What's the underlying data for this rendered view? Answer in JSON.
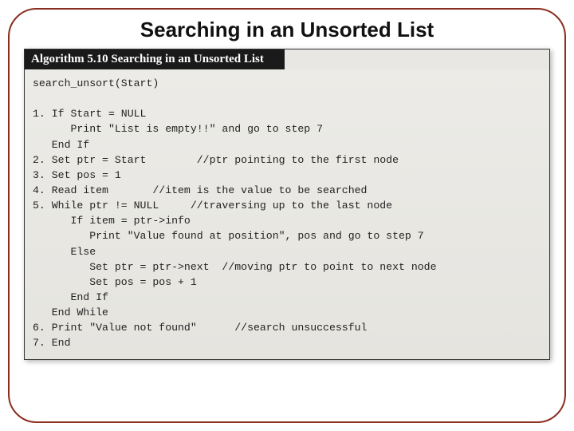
{
  "title": "Searching in an Unsorted List",
  "algorithm": {
    "header": "Algorithm 5.10 Searching in an Unsorted List",
    "signature": "search_unsort(Start)",
    "lines": [
      "1. If Start = NULL",
      "      Print \"List is empty!!\" and go to step 7",
      "   End If",
      "2. Set ptr = Start        //ptr pointing to the first node",
      "3. Set pos = 1",
      "4. Read item       //item is the value to be searched",
      "5. While ptr != NULL     //traversing up to the last node",
      "      If item = ptr->info",
      "         Print \"Value found at position\", pos and go to step 7",
      "      Else",
      "         Set ptr = ptr->next  //moving ptr to point to next node",
      "         Set pos = pos + 1",
      "      End If",
      "   End While",
      "6. Print \"Value not found\"      //search unsuccessful",
      "7. End"
    ]
  }
}
